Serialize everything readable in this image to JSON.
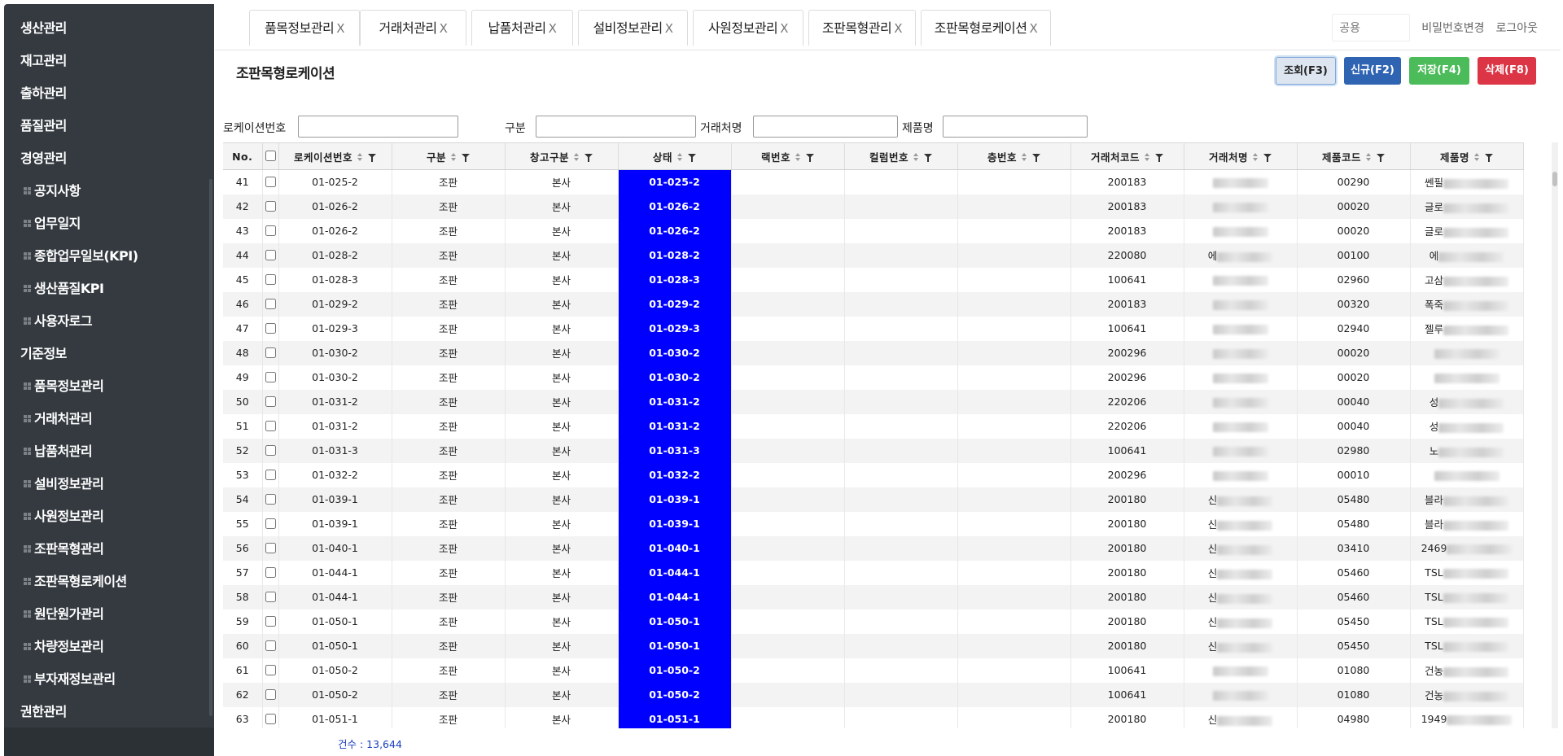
{
  "sidebar": {
    "items": [
      {
        "label": "생산관리",
        "sub": false
      },
      {
        "label": "재고관리",
        "sub": false
      },
      {
        "label": "출하관리",
        "sub": false
      },
      {
        "label": "품질관리",
        "sub": false
      },
      {
        "label": "경영관리",
        "sub": false
      },
      {
        "label": "공지사항",
        "sub": true
      },
      {
        "label": "업무일지",
        "sub": true
      },
      {
        "label": "종합업무일보(KPI)",
        "sub": true
      },
      {
        "label": "생산품질KPI",
        "sub": true
      },
      {
        "label": "사용자로그",
        "sub": true
      },
      {
        "label": "기준정보",
        "sub": false
      },
      {
        "label": "품목정보관리",
        "sub": true
      },
      {
        "label": "거래처관리",
        "sub": true
      },
      {
        "label": "납품처관리",
        "sub": true
      },
      {
        "label": "설비정보관리",
        "sub": true
      },
      {
        "label": "사원정보관리",
        "sub": true
      },
      {
        "label": "조판목형관리",
        "sub": true
      },
      {
        "label": "조판목형로케이션",
        "sub": true
      },
      {
        "label": "원단원가관리",
        "sub": true
      },
      {
        "label": "차량정보관리",
        "sub": true
      },
      {
        "label": "부자재정보관리",
        "sub": true
      },
      {
        "label": "권한관리",
        "sub": false
      }
    ]
  },
  "tabs": [
    {
      "label": "품목정보관리",
      "close": "X"
    },
    {
      "label": "거래처관리",
      "close": "X"
    },
    {
      "label": "납품처관리",
      "close": "X"
    },
    {
      "label": "설비정보관리",
      "close": "X"
    },
    {
      "label": "사원정보관리",
      "close": "X"
    },
    {
      "label": "조판목형관리",
      "close": "X"
    },
    {
      "label": "조판목형로케이션",
      "close": "X"
    }
  ],
  "header": {
    "user_placeholder": "공용",
    "change_password": "비밀번호변경",
    "logout": "로그아웃"
  },
  "page": {
    "title": "조판목형로케이션"
  },
  "toolbar": {
    "search": "조회(F3)",
    "new": "신규(F2)",
    "save": "저장(F4)",
    "delete": "삭제(F8)"
  },
  "filters": {
    "location_no": "로케이션번호",
    "category": "구분",
    "client_name": "거래처명",
    "product_name": "제품명"
  },
  "grid": {
    "columns": [
      "No.",
      "",
      "로케이션번호",
      "구분",
      "창고구분",
      "상태",
      "랙번호",
      "컬럼번호",
      "층번호",
      "거래처코드",
      "거래처명",
      "제품코드",
      "제품명"
    ],
    "rows": [
      {
        "no": "41",
        "loc": "01-025-2",
        "type": "조판",
        "wh": "본사",
        "status": "01-025-2",
        "rack": "",
        "col": "",
        "floor": "",
        "ccode": "200183",
        "cname": "",
        "pcode": "00290",
        "pname": "쎈필"
      },
      {
        "no": "42",
        "loc": "01-026-2",
        "type": "조판",
        "wh": "본사",
        "status": "01-026-2",
        "rack": "",
        "col": "",
        "floor": "",
        "ccode": "200183",
        "cname": "",
        "pcode": "00020",
        "pname": "글로"
      },
      {
        "no": "43",
        "loc": "01-026-2",
        "type": "조판",
        "wh": "본사",
        "status": "01-026-2",
        "rack": "",
        "col": "",
        "floor": "",
        "ccode": "200183",
        "cname": "",
        "pcode": "00020",
        "pname": "글로"
      },
      {
        "no": "44",
        "loc": "01-028-2",
        "type": "조판",
        "wh": "본사",
        "status": "01-028-2",
        "rack": "",
        "col": "",
        "floor": "",
        "ccode": "220080",
        "cname": "에",
        "pcode": "00100",
        "pname": "에"
      },
      {
        "no": "45",
        "loc": "01-028-3",
        "type": "조판",
        "wh": "본사",
        "status": "01-028-3",
        "rack": "",
        "col": "",
        "floor": "",
        "ccode": "100641",
        "cname": "",
        "pcode": "02960",
        "pname": "고삼"
      },
      {
        "no": "46",
        "loc": "01-029-2",
        "type": "조판",
        "wh": "본사",
        "status": "01-029-2",
        "rack": "",
        "col": "",
        "floor": "",
        "ccode": "200183",
        "cname": "",
        "pcode": "00320",
        "pname": "폭죽"
      },
      {
        "no": "47",
        "loc": "01-029-3",
        "type": "조판",
        "wh": "본사",
        "status": "01-029-3",
        "rack": "",
        "col": "",
        "floor": "",
        "ccode": "100641",
        "cname": "",
        "pcode": "02940",
        "pname": "젤루"
      },
      {
        "no": "48",
        "loc": "01-030-2",
        "type": "조판",
        "wh": "본사",
        "status": "01-030-2",
        "rack": "",
        "col": "",
        "floor": "",
        "ccode": "200296",
        "cname": "",
        "pcode": "00020",
        "pname": ""
      },
      {
        "no": "49",
        "loc": "01-030-2",
        "type": "조판",
        "wh": "본사",
        "status": "01-030-2",
        "rack": "",
        "col": "",
        "floor": "",
        "ccode": "200296",
        "cname": "",
        "pcode": "00020",
        "pname": ""
      },
      {
        "no": "50",
        "loc": "01-031-2",
        "type": "조판",
        "wh": "본사",
        "status": "01-031-2",
        "rack": "",
        "col": "",
        "floor": "",
        "ccode": "220206",
        "cname": "",
        "pcode": "00040",
        "pname": "성"
      },
      {
        "no": "51",
        "loc": "01-031-2",
        "type": "조판",
        "wh": "본사",
        "status": "01-031-2",
        "rack": "",
        "col": "",
        "floor": "",
        "ccode": "220206",
        "cname": "",
        "pcode": "00040",
        "pname": "성"
      },
      {
        "no": "52",
        "loc": "01-031-3",
        "type": "조판",
        "wh": "본사",
        "status": "01-031-3",
        "rack": "",
        "col": "",
        "floor": "",
        "ccode": "100641",
        "cname": "",
        "pcode": "02980",
        "pname": "노"
      },
      {
        "no": "53",
        "loc": "01-032-2",
        "type": "조판",
        "wh": "본사",
        "status": "01-032-2",
        "rack": "",
        "col": "",
        "floor": "",
        "ccode": "200296",
        "cname": "",
        "pcode": "00010",
        "pname": ""
      },
      {
        "no": "54",
        "loc": "01-039-1",
        "type": "조판",
        "wh": "본사",
        "status": "01-039-1",
        "rack": "",
        "col": "",
        "floor": "",
        "ccode": "200180",
        "cname": "신",
        "pcode": "05480",
        "pname": "블라"
      },
      {
        "no": "55",
        "loc": "01-039-1",
        "type": "조판",
        "wh": "본사",
        "status": "01-039-1",
        "rack": "",
        "col": "",
        "floor": "",
        "ccode": "200180",
        "cname": "신",
        "pcode": "05480",
        "pname": "블라"
      },
      {
        "no": "56",
        "loc": "01-040-1",
        "type": "조판",
        "wh": "본사",
        "status": "01-040-1",
        "rack": "",
        "col": "",
        "floor": "",
        "ccode": "200180",
        "cname": "신",
        "pcode": "03410",
        "pname": "2469"
      },
      {
        "no": "57",
        "loc": "01-044-1",
        "type": "조판",
        "wh": "본사",
        "status": "01-044-1",
        "rack": "",
        "col": "",
        "floor": "",
        "ccode": "200180",
        "cname": "신",
        "pcode": "05460",
        "pname": "TSL"
      },
      {
        "no": "58",
        "loc": "01-044-1",
        "type": "조판",
        "wh": "본사",
        "status": "01-044-1",
        "rack": "",
        "col": "",
        "floor": "",
        "ccode": "200180",
        "cname": "신",
        "pcode": "05460",
        "pname": "TSL"
      },
      {
        "no": "59",
        "loc": "01-050-1",
        "type": "조판",
        "wh": "본사",
        "status": "01-050-1",
        "rack": "",
        "col": "",
        "floor": "",
        "ccode": "200180",
        "cname": "신",
        "pcode": "05450",
        "pname": "TSL"
      },
      {
        "no": "60",
        "loc": "01-050-1",
        "type": "조판",
        "wh": "본사",
        "status": "01-050-1",
        "rack": "",
        "col": "",
        "floor": "",
        "ccode": "200180",
        "cname": "신",
        "pcode": "05450",
        "pname": "TSL"
      },
      {
        "no": "61",
        "loc": "01-050-2",
        "type": "조판",
        "wh": "본사",
        "status": "01-050-2",
        "rack": "",
        "col": "",
        "floor": "",
        "ccode": "100641",
        "cname": "",
        "pcode": "01080",
        "pname": "건농"
      },
      {
        "no": "62",
        "loc": "01-050-2",
        "type": "조판",
        "wh": "본사",
        "status": "01-050-2",
        "rack": "",
        "col": "",
        "floor": "",
        "ccode": "100641",
        "cname": "",
        "pcode": "01080",
        "pname": "건농"
      },
      {
        "no": "63",
        "loc": "01-051-1",
        "type": "조판",
        "wh": "본사",
        "status": "01-051-1",
        "rack": "",
        "col": "",
        "floor": "",
        "ccode": "200180",
        "cname": "신",
        "pcode": "04980",
        "pname": "1949"
      }
    ]
  },
  "footer": {
    "count_text": "건수 : 13,644"
  },
  "colors": {
    "sidebar_bg": "#343a40",
    "status_cell": "#0000ff",
    "btn_new": "#2f64b3",
    "btn_save": "#4cbb5a",
    "btn_delete": "#dc3545"
  }
}
